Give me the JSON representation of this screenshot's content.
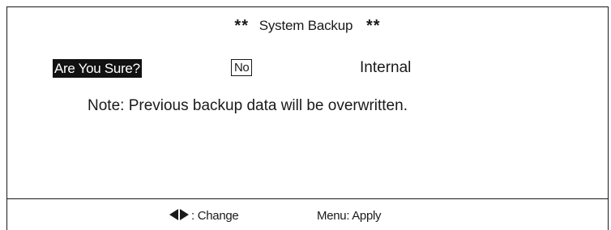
{
  "screen": {
    "title_stars_left": "**",
    "title": "System Backup",
    "title_stars_right": "**"
  },
  "confirm": {
    "prompt": "Are You Sure?",
    "selected_option": "No",
    "target": "Internal"
  },
  "note": "Note:  Previous backup data will be overwritten.",
  "footer": {
    "change_icon": "left-right-arrows-icon",
    "change_label": ": Change",
    "apply_label": "Menu: Apply"
  }
}
